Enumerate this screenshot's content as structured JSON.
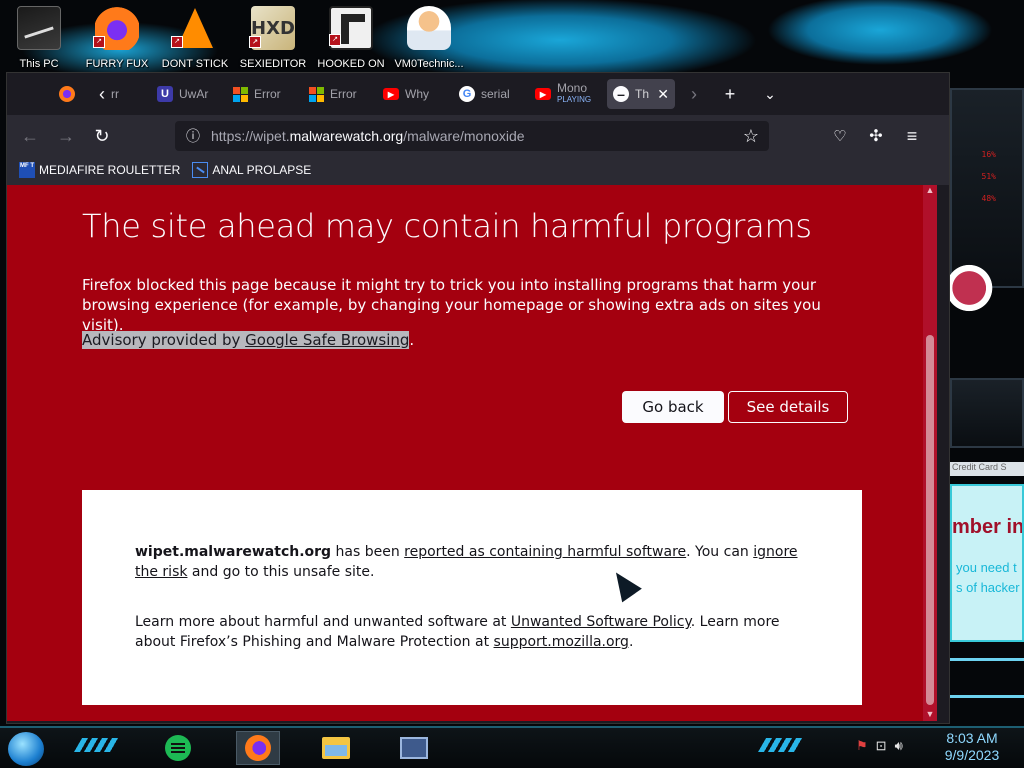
{
  "desktop": {
    "icons": [
      {
        "label": "This PC",
        "icon": "computer-icon"
      },
      {
        "label": "FURRY FUX",
        "icon": "firefox-icon"
      },
      {
        "label": "DONT STICK",
        "icon": "vlc-icon"
      },
      {
        "label": "SEXIEDITOR",
        "icon": "hxd-icon"
      },
      {
        "label": "HOOKED ON",
        "icon": "hooked-icon"
      },
      {
        "label": "VM0Technic...",
        "icon": "doctor-icon"
      }
    ],
    "side_stats": [
      "16%",
      "51%",
      "48%"
    ],
    "side_text": [
      "Credit Card S",
      "mber in",
      "you need t",
      "s of hacker"
    ]
  },
  "browser": {
    "tabs": [
      {
        "title": "rr",
        "icon": "back-arrow-icon"
      },
      {
        "title": "UwAr",
        "icon": "uwa-icon"
      },
      {
        "title": "Error",
        "icon": "microsoft-icon"
      },
      {
        "title": "Error",
        "icon": "microsoft-icon"
      },
      {
        "title": "Why",
        "icon": "youtube-icon"
      },
      {
        "title": "serial",
        "icon": "google-icon"
      },
      {
        "title": "Mono",
        "subtitle": "PLAYING",
        "icon": "youtube-icon"
      },
      {
        "title": "Th",
        "icon": "blocked-icon",
        "active": true
      }
    ],
    "url": {
      "prefix": "https://wipet.",
      "domain": "malwarewatch.org",
      "path": "/malware/monoxide"
    },
    "bookmarks": [
      {
        "label": "MEDIAFIRE ROULETTER",
        "icon_text": "MF T"
      },
      {
        "label": "ANAL PROLAPSE"
      }
    ]
  },
  "warning": {
    "title": "The site ahead may contain harmful programs",
    "description": "Firefox blocked this page because it might try to trick you into installing programs that harm your browsing experience (for example, by changing your homepage or showing extra ads on sites you visit).",
    "advisory_prefix": "Advisory provided by ",
    "advisory_link": "Google Safe Browsing",
    "advisory_suffix": ".",
    "go_back": "Go back",
    "see_details": "See details",
    "details": {
      "site": "wipet.malwarewatch.org",
      "has_been": " has been ",
      "reported_link": "reported as containing harmful software",
      "you_can": ". You can ",
      "ignore_link": "ignore the risk",
      "go_on": " and go to this unsafe site.",
      "learn_prefix": "Learn more about harmful and unwanted software at ",
      "policy_link": "Unwanted Software Policy",
      "learn_mid": ". Learn more about Firefox’s Phishing and Malware Protection at ",
      "support_link": "support.mozilla.org",
      "learn_suffix": "."
    }
  },
  "taskbar": {
    "apps": [
      "spotify-icon",
      "firefox-icon",
      "file-explorer-icon",
      "control-panel-icon"
    ],
    "time": "8:03 AM",
    "date": "9/9/2023"
  },
  "colors": {
    "warning_bg": "#a4000f",
    "browser_bg": "#1c1b22",
    "toolbar_bg": "#2b2a33"
  }
}
